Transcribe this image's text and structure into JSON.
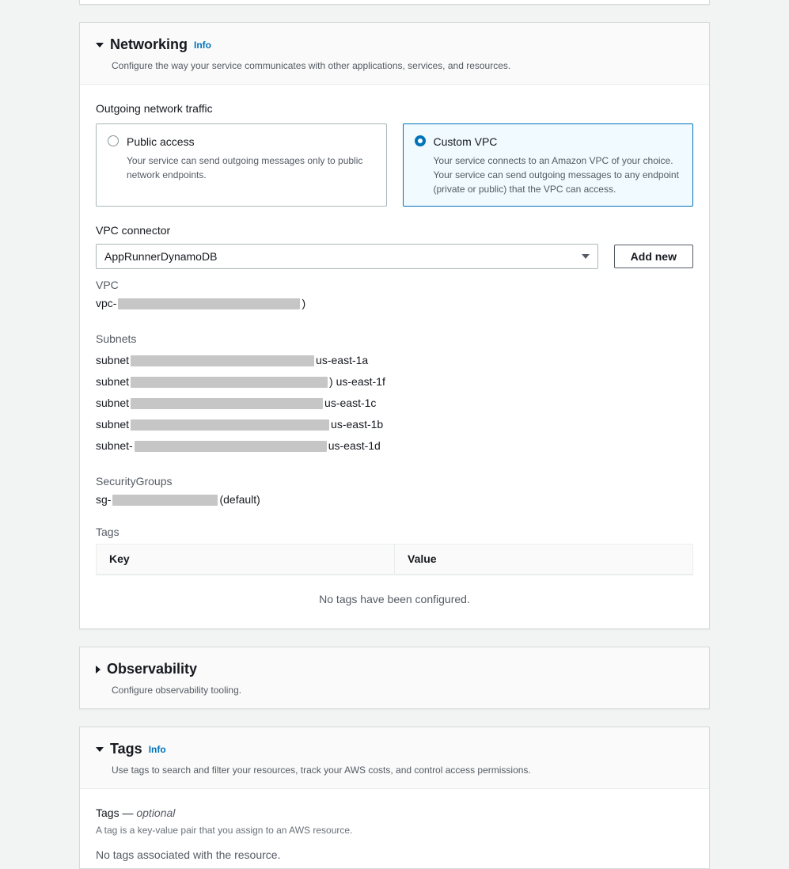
{
  "networking": {
    "title": "Networking",
    "info": "Info",
    "subtitle": "Configure the way your service communicates with other applications, services, and resources.",
    "outgoing_label": "Outgoing network traffic",
    "public_option": {
      "title": "Public access",
      "desc": "Your service can send outgoing messages only to public network endpoints."
    },
    "custom_option": {
      "title": "Custom VPC",
      "desc": "Your service connects to an Amazon VPC of your choice. Your service can send outgoing messages to any endpoint (private or public) that the VPC can access."
    },
    "vpc_connector_label": "VPC connector",
    "vpc_connector_value": "AppRunnerDynamoDB",
    "add_new": "Add new",
    "vpc_label": "VPC",
    "vpc_prefix": "vpc-",
    "vpc_suffix": ")",
    "subnets_label": "Subnets",
    "subnets": [
      {
        "prefix": "subnet",
        "zone": " us-east-1a"
      },
      {
        "prefix": "subnet",
        "zone": ") us-east-1f"
      },
      {
        "prefix": "subnet",
        "zone": " us-east-1c"
      },
      {
        "prefix": "subnet",
        "zone": " us-east-1b"
      },
      {
        "prefix": "subnet-",
        "zone": " us-east-1d"
      }
    ],
    "sg_label": "SecurityGroups",
    "sg_prefix": "sg-",
    "sg_suffix": " (default)",
    "tags_label": "Tags",
    "tags_table": {
      "key": "Key",
      "value": "Value",
      "empty": "No tags have been configured."
    }
  },
  "observability": {
    "title": "Observability",
    "subtitle": "Configure observability tooling."
  },
  "tags": {
    "title": "Tags",
    "info": "Info",
    "subtitle": "Use tags to search and filter your resources, track your AWS costs, and control access permissions.",
    "heading": "Tags —",
    "optional": " optional",
    "desc": "A tag is a key-value pair that you assign to an AWS resource.",
    "none": "No tags associated with the resource."
  }
}
